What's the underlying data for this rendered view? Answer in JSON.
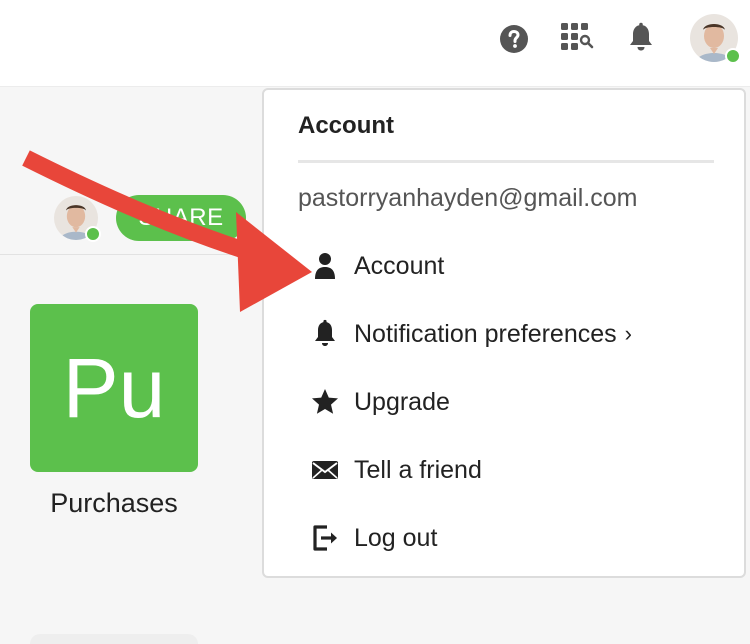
{
  "topbar": {
    "icons": [
      "help-icon",
      "apps-search-icon",
      "bell-icon"
    ],
    "avatar": "user-avatar",
    "status_color": "#5cc04c"
  },
  "file": {
    "share_label": "SHARE",
    "app_tile_text": "Pu",
    "app_label": "Purchases"
  },
  "dropdown": {
    "title": "Account",
    "email": "pastorryanhayden@gmail.com",
    "items": [
      {
        "label": "Account",
        "icon": "person-icon"
      },
      {
        "label": "Notification preferences",
        "icon": "bell-icon",
        "chevron": "›"
      },
      {
        "label": "Upgrade",
        "icon": "star-icon"
      },
      {
        "label": "Tell a friend",
        "icon": "envelope-icon"
      },
      {
        "label": "Log out",
        "icon": "logout-icon"
      }
    ]
  },
  "colors": {
    "accent_green": "#5cc04c",
    "annotation_arrow": "#e8463a"
  }
}
